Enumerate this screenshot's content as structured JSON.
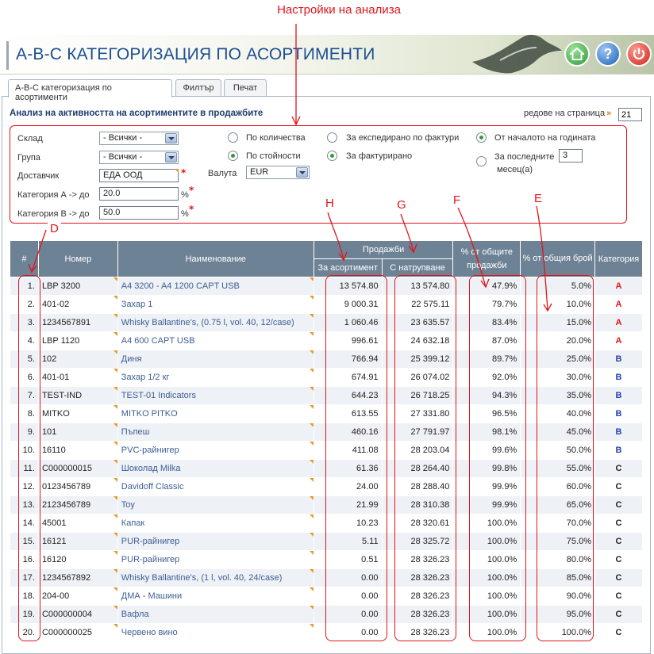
{
  "annotation": {
    "top_label": "Настройки на анализа",
    "letters": {
      "d": "D",
      "h": "H",
      "g": "G",
      "f": "F",
      "e": "E"
    }
  },
  "header": {
    "title": "А-В-С КАТЕГОРИЗАЦИЯ ПО АСОРТИМЕНТИ"
  },
  "tabs": [
    "А-В-С категоризация по асортименти",
    "Филтър",
    "Печат"
  ],
  "section": {
    "title": "Анализ на активността на асортиментите в продажбите",
    "rows_per_page_label": "редове на страница",
    "rows_per_page_arrow": "»",
    "rows_per_page": "21"
  },
  "filters": {
    "warehouse_label": "Склад",
    "warehouse_value": "- Всички -",
    "group_label": "Група",
    "group_value": "- Всички -",
    "supplier_label": "Доставчик",
    "supplier_value": "ЕДА ООД",
    "cat_a_label": "Категория А -> до",
    "cat_a_value": "20.0",
    "cat_b_label": "Категория В -> до",
    "cat_b_value": "50.0",
    "percent": "%",
    "required": "*",
    "currency_label": "Валута",
    "currency_value": "EUR",
    "by_quantity": "По количества",
    "by_value": "По стойности",
    "by_shipped": "За експедирано по фактури",
    "by_invoiced": "За фактурирано",
    "from_year_start": "От началото на годината",
    "last_label": "За последните",
    "last_value": "3",
    "months_label": "месец(а)"
  },
  "table": {
    "headers": {
      "no": "#",
      "code": "Номер",
      "name": "Наименование",
      "sales": "Продажби",
      "sales_item": "За асортимент",
      "sales_cum": "С натрупване",
      "pct_sales": "% от общите продажби",
      "pct_count": "% от общия брой",
      "category": "Категория"
    },
    "rows": [
      {
        "no": "1.",
        "code": "LBP 3200",
        "name": "A4 3200 - A4 1200 CAPT USB",
        "v": "13 574.80",
        "c": "13 574.80",
        "ps": "47.9%",
        "pc": "5.0%",
        "cat": "A"
      },
      {
        "no": "2.",
        "code": "401-02",
        "name": "Захар 1",
        "v": "9 000.31",
        "c": "22 575.11",
        "ps": "79.7%",
        "pc": "10.0%",
        "cat": "A"
      },
      {
        "no": "3.",
        "code": "1234567891",
        "name": "Whisky Ballantine's, (0.75 l, vol. 40, 12/case)",
        "v": "1 060.46",
        "c": "23 635.57",
        "ps": "83.4%",
        "pc": "15.0%",
        "cat": "A"
      },
      {
        "no": "4.",
        "code": "LBP 1120",
        "name": "A4 600 CAPT USB",
        "v": "996.61",
        "c": "24 632.18",
        "ps": "87.0%",
        "pc": "20.0%",
        "cat": "A"
      },
      {
        "no": "5.",
        "code": "102",
        "name": "Диня",
        "v": "766.94",
        "c": "25 399.12",
        "ps": "89.7%",
        "pc": "25.0%",
        "cat": "B"
      },
      {
        "no": "6.",
        "code": "401-01",
        "name": "Захар 1/2 кг",
        "v": "674.91",
        "c": "26 074.02",
        "ps": "92.0%",
        "pc": "30.0%",
        "cat": "B"
      },
      {
        "no": "7.",
        "code": "TEST-IND",
        "name": "TEST-01 Indicators",
        "v": "644.23",
        "c": "26 718.25",
        "ps": "94.3%",
        "pc": "35.0%",
        "cat": "B"
      },
      {
        "no": "8.",
        "code": "MITKO",
        "name": "MITKO PITKO",
        "v": "613.55",
        "c": "27 331.80",
        "ps": "96.5%",
        "pc": "40.0%",
        "cat": "B"
      },
      {
        "no": "9.",
        "code": "101",
        "name": "Пъпеш",
        "v": "460.16",
        "c": "27 791.97",
        "ps": "98.1%",
        "pc": "45.0%",
        "cat": "B"
      },
      {
        "no": "10.",
        "code": "16110",
        "name": "PVC-райнигер",
        "v": "411.08",
        "c": "28 203.04",
        "ps": "99.6%",
        "pc": "50.0%",
        "cat": "B"
      },
      {
        "no": "11.",
        "code": "C000000015",
        "name": "Шоколад Milka",
        "v": "61.36",
        "c": "28 264.40",
        "ps": "99.8%",
        "pc": "55.0%",
        "cat": "C"
      },
      {
        "no": "12.",
        "code": "0123456789",
        "name": "Davidoff Classic",
        "v": "24.00",
        "c": "28 288.40",
        "ps": "99.9%",
        "pc": "60.0%",
        "cat": "C"
      },
      {
        "no": "13.",
        "code": "2123456789",
        "name": "Toy",
        "v": "21.99",
        "c": "28 310.38",
        "ps": "99.9%",
        "pc": "65.0%",
        "cat": "C"
      },
      {
        "no": "14.",
        "code": "45001",
        "name": "Капак",
        "v": "10.23",
        "c": "28 320.61",
        "ps": "100.0%",
        "pc": "70.0%",
        "cat": "C"
      },
      {
        "no": "15.",
        "code": "16121",
        "name": "PUR-райнигер",
        "v": "5.11",
        "c": "28 325.72",
        "ps": "100.0%",
        "pc": "75.0%",
        "cat": "C"
      },
      {
        "no": "16.",
        "code": "16120",
        "name": "PUR-райнигер",
        "v": "0.51",
        "c": "28 326.23",
        "ps": "100.0%",
        "pc": "80.0%",
        "cat": "C"
      },
      {
        "no": "17.",
        "code": "1234567892",
        "name": "Whisky Ballantine's, (1 l, vol. 40, 24/case)",
        "v": "0.00",
        "c": "28 326.23",
        "ps": "100.0%",
        "pc": "85.0%",
        "cat": "C"
      },
      {
        "no": "18.",
        "code": "204-00",
        "name": "ДМА - Машини",
        "v": "0.00",
        "c": "28 326.23",
        "ps": "100.0%",
        "pc": "90.0%",
        "cat": "C"
      },
      {
        "no": "19.",
        "code": "C000000004",
        "name": "Вафла",
        "v": "0.00",
        "c": "28 326.23",
        "ps": "100.0%",
        "pc": "95.0%",
        "cat": "C"
      },
      {
        "no": "20.",
        "code": "C000000025",
        "name": "Червено вино",
        "v": "0.00",
        "c": "28 326.23",
        "ps": "100.0%",
        "pc": "100.0%",
        "cat": "C"
      }
    ]
  },
  "colors": {
    "annotation": "#e0141b",
    "header_bg": "#6e8296",
    "title": "#1d4f91",
    "link": "#3d5e96",
    "cat_a": "#e0141b",
    "cat_b": "#2a3fb0",
    "cat_c": "#222222"
  },
  "icons": {
    "home": "home-icon",
    "help": "help-icon",
    "power": "power-icon"
  }
}
